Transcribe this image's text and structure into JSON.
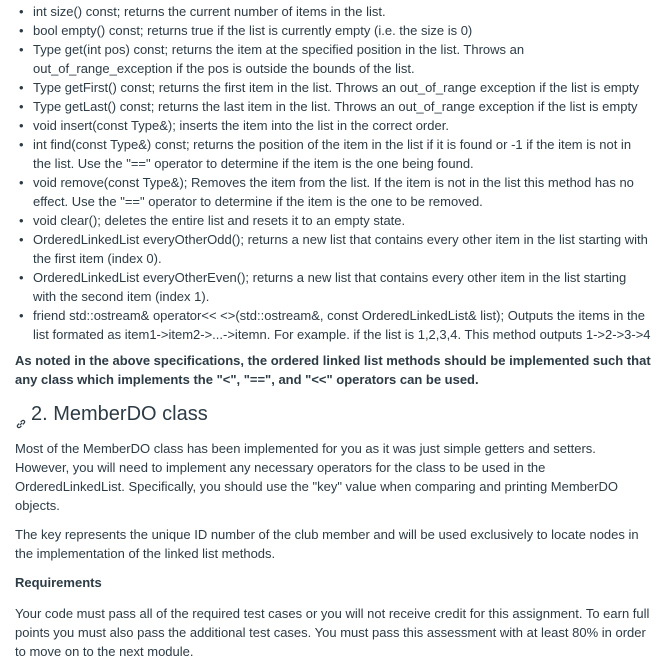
{
  "methods": [
    "int size() const; returns the current number of items in the list.",
    "bool empty() const; returns true if the list is currently empty (i.e. the size is 0)",
    "Type get(int pos) const; returns the item at the specified position in the list. Throws an out_of_range_exception if the pos is outside the bounds of the list.",
    "Type getFirst() const; returns the first item in the list. Throws an out_of_range exception if the list is empty",
    "Type getLast() const; returns the last item in the list. Throws an out_of_range exception if the list is empty",
    "void insert(const Type&); inserts the item into the list in the correct order.",
    "int find(const Type&) const; returns the position of the item in the list if it is found or -1 if the item is not in the list. Use the \"==\" operator to determine if the item is the one being found.",
    "void remove(const Type&); Removes the item from the list. If the item is not in the list this method has no effect. Use the \"==\" operator to determine if the item is the one to be removed.",
    "void clear(); deletes the entire list and resets it to an empty state.",
    "OrderedLinkedList everyOtherOdd(); returns a new list that contains every other item in the list starting with the first item (index 0).",
    "OrderedLinkedList everyOtherEven(); returns a new list that contains every other item in the list starting with the second item (index 1).",
    "friend std::ostream& operator<< <>(std::ostream&, const OrderedLinkedList& list); Outputs the items in the list formated as item1->item2->...->itemn. For example. if the list is 1,2,3,4. This method outputs 1->2->3->4"
  ],
  "note": "As noted in the above specifications, the ordered linked list methods should be implemented such that any class which implements the \"<\", \"==\", and \"<<\" operators can be used.",
  "section": {
    "title": "2. MemberDO class",
    "icon": "link-icon",
    "paragraphs": [
      "Most of the MemberDO class has been implemented for you as it was just simple getters and setters. However, you will need to implement any necessary operators for the class to be used in the OrderedLinkedList. Specifically, you should use the \"key\" value when comparing and printing MemberDO objects.",
      "The key represents the unique ID number of the club member and will be used exclusively to locate nodes in the implementation of the linked list methods."
    ],
    "requirements_heading": "Requirements",
    "requirements_text": "Your code must pass all of the required test cases or you will not receive credit for this assignment.  To earn full points you must also pass the additional test cases.  You must pass this assessment with at least 80% in order to move on to the next module."
  }
}
